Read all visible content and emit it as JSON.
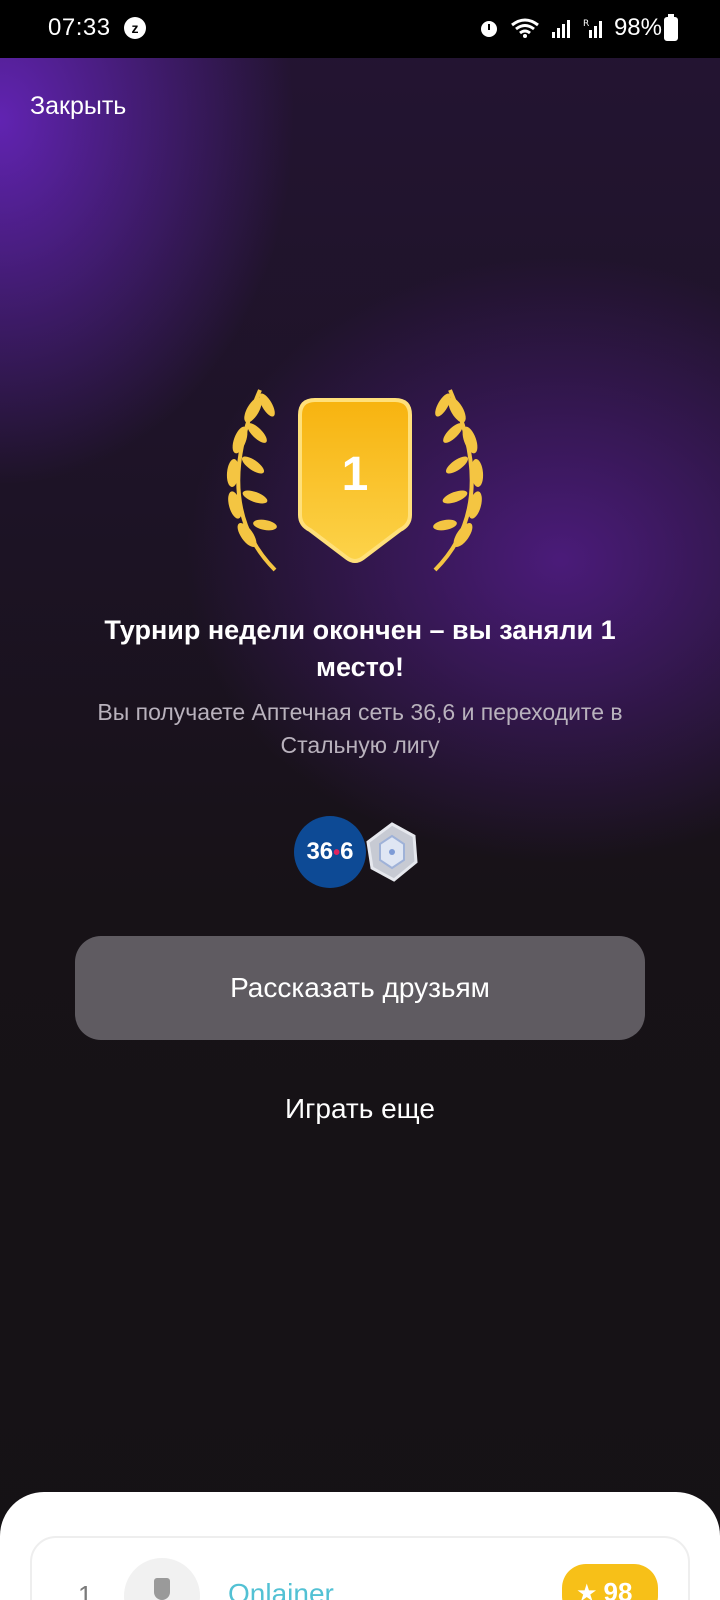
{
  "status_bar": {
    "time": "07:33",
    "battery": "98%",
    "icons": [
      "alarm-snooze-icon",
      "alarm-icon",
      "wifi-icon",
      "signal-icon",
      "roaming-signal-icon",
      "battery-icon"
    ]
  },
  "header": {
    "close_label": "Закрыть"
  },
  "trophy": {
    "place": "1",
    "colors": {
      "shield": "#f5b716",
      "laurel": "#f4c542"
    }
  },
  "result": {
    "title": "Турнир недели окончен – вы заняли 1 место!",
    "subtitle": "Вы получаете Аптечная сеть 36,6 и переходите в Стальную лигу"
  },
  "rewards": {
    "partner_logo_left": "36",
    "partner_logo_right": "6",
    "league_icon": "steel-league-badge-icon"
  },
  "actions": {
    "share_label": "Рассказать друзьям",
    "play_again_label": "Играть еще"
  },
  "leaderboard": {
    "rows": [
      {
        "rank": "1",
        "name": "Onlainer",
        "score": "98"
      }
    ]
  }
}
